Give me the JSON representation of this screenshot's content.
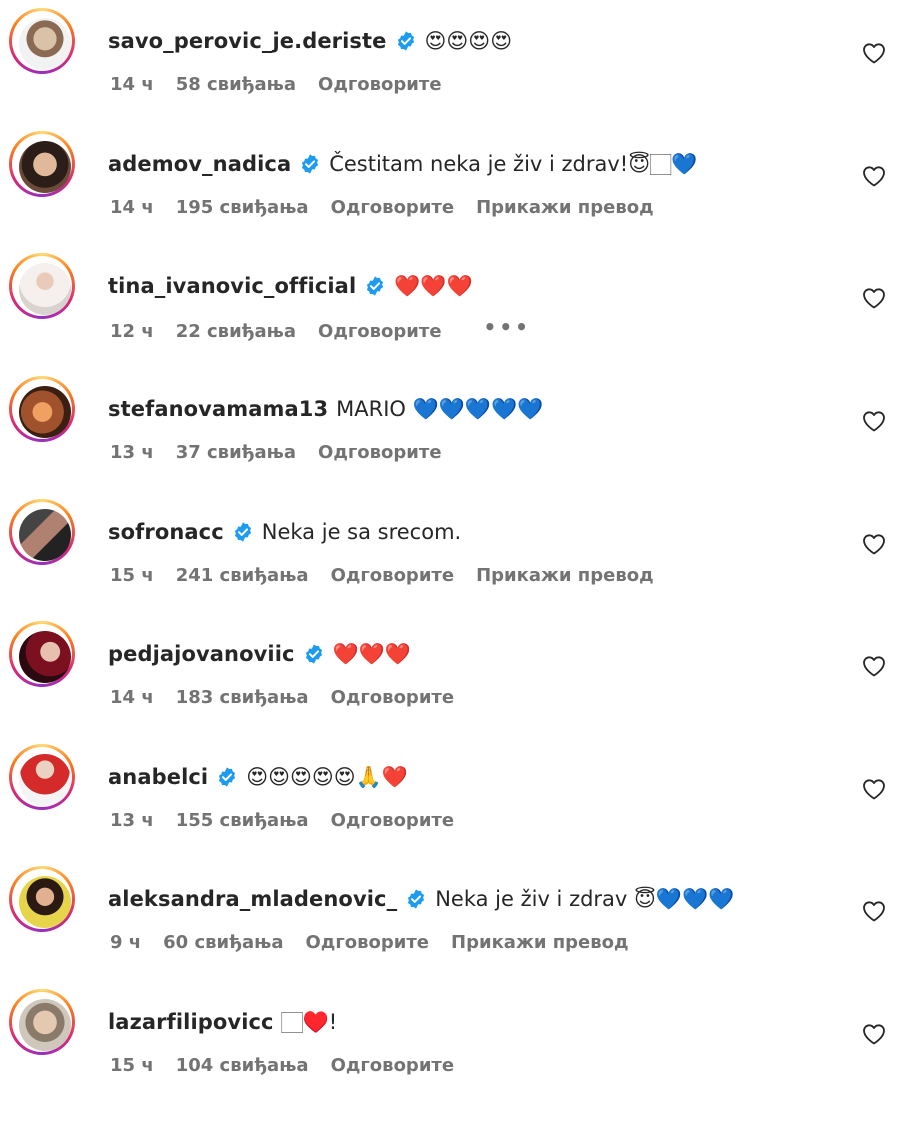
{
  "like_icon": "heart-outline-icon",
  "colors": {
    "verified": "#1d9bf0",
    "text": "#262626",
    "meta": "#737373"
  },
  "comments": [
    {
      "username": "savo_perovic_je.deriste",
      "verified": true,
      "text": "😍😍😍😍",
      "time": "14 ч",
      "likes": "58 свиђања",
      "reply": "Одговорите",
      "translate": "",
      "more": ""
    },
    {
      "username": "ademov_nadica",
      "verified": true,
      "text": "Čestitam neka je živ i zdrav!😇🏻💙",
      "time": "14 ч",
      "likes": "195 свиђања",
      "reply": "Одговорите",
      "translate": "Прикажи превод",
      "more": ""
    },
    {
      "username": "tina_ivanovic_official",
      "verified": true,
      "text": "❤️❤️❤️",
      "time": "12 ч",
      "likes": "22 свиђања",
      "reply": "Одговорите",
      "translate": "",
      "more": "•••"
    },
    {
      "username": "stefanovamama13",
      "verified": false,
      "text": "MARIO 💙💙💙💙💙",
      "time": "13 ч",
      "likes": "37 свиђања",
      "reply": "Одговорите",
      "translate": "",
      "more": ""
    },
    {
      "username": "sofronacc",
      "verified": true,
      "text": "Neka je sa srecom.",
      "time": "15 ч",
      "likes": "241 свиђања",
      "reply": "Одговорите",
      "translate": "Прикажи превод",
      "more": ""
    },
    {
      "username": "pedjajovanoviic",
      "verified": true,
      "text": "❤️❤️❤️",
      "time": "14 ч",
      "likes": "183 свиђања",
      "reply": "Одговорите",
      "translate": "",
      "more": ""
    },
    {
      "username": "anabelci",
      "verified": true,
      "text": "😍😍😍😍😍🙏❤️",
      "time": "13 ч",
      "likes": "155 свиђања",
      "reply": "Одговорите",
      "translate": "",
      "more": ""
    },
    {
      "username": "aleksandra_mladenovic_",
      "verified": true,
      "text": "Neka je živ i zdrav 😇💙💙💙",
      "time": "9 ч",
      "likes": "60 свиђања",
      "reply": "Одговорите",
      "translate": "Прикажи превод",
      "more": ""
    },
    {
      "username": "lazarfilipovicc",
      "verified": false,
      "text": "🏻♥️!",
      "time": "15 ч",
      "likes": "104 свиђања",
      "reply": "Одговорите",
      "translate": "",
      "more": ""
    }
  ]
}
